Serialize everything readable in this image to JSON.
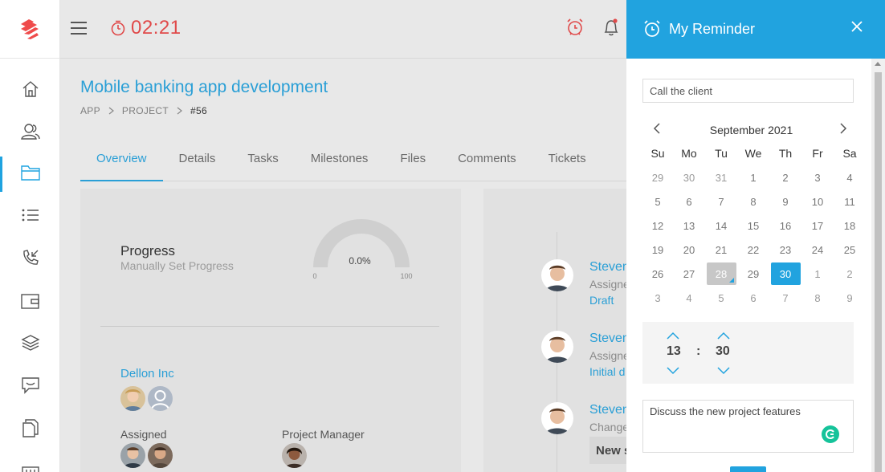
{
  "header": {
    "timer": "02:21",
    "timer_color": "#e04a4a"
  },
  "sidebar": {
    "items": [
      {
        "icon": "home-icon"
      },
      {
        "icon": "users-icon"
      },
      {
        "icon": "folder-icon",
        "active": true
      },
      {
        "icon": "list-icon"
      },
      {
        "icon": "phone-icon"
      },
      {
        "icon": "wallet-icon"
      },
      {
        "icon": "layers-icon"
      },
      {
        "icon": "chat-icon"
      },
      {
        "icon": "documents-icon"
      },
      {
        "icon": "settings-icon"
      }
    ]
  },
  "project": {
    "title": "Mobile banking app development",
    "breadcrumb": [
      "APP",
      "PROJECT",
      "#56"
    ],
    "tabs": [
      "Overview",
      "Details",
      "Tasks",
      "Milestones",
      "Files",
      "Comments",
      "Tickets"
    ],
    "active_tab": "Overview",
    "progress_label": "Progress",
    "progress_sub": "Manually Set Progress",
    "progress_value": "0.0%",
    "gauge_min": "0",
    "gauge_max": "100",
    "company": "Dellon Inc",
    "assigned_label": "Assigned",
    "pm_label": "Project Manager"
  },
  "activity": [
    {
      "name": "Steven",
      "line2": "Assigne",
      "line3": "Draft"
    },
    {
      "name": "Steven",
      "line2": "Assigne",
      "line3": "Initial d"
    },
    {
      "name": "Steven",
      "line2": "Change",
      "box": "New s"
    }
  ],
  "reminder": {
    "title": "My Reminder",
    "input_value": "Call the client",
    "month": "September 2021",
    "weekdays": [
      "Su",
      "Mo",
      "Tu",
      "We",
      "Th",
      "Fr",
      "Sa"
    ],
    "weeks": [
      [
        "29",
        "30",
        "31",
        "1",
        "2",
        "3",
        "4"
      ],
      [
        "5",
        "6",
        "7",
        "8",
        "9",
        "10",
        "11"
      ],
      [
        "12",
        "13",
        "14",
        "15",
        "16",
        "17",
        "18"
      ],
      [
        "19",
        "20",
        "21",
        "22",
        "23",
        "24",
        "25"
      ],
      [
        "26",
        "27",
        "28",
        "29",
        "30",
        "1",
        "2"
      ],
      [
        "3",
        "4",
        "5",
        "6",
        "7",
        "8",
        "9"
      ]
    ],
    "hour": "13",
    "separator": ":",
    "minute": "30",
    "notes": "Discuss the new project features",
    "accent_color": "#21a3df"
  }
}
